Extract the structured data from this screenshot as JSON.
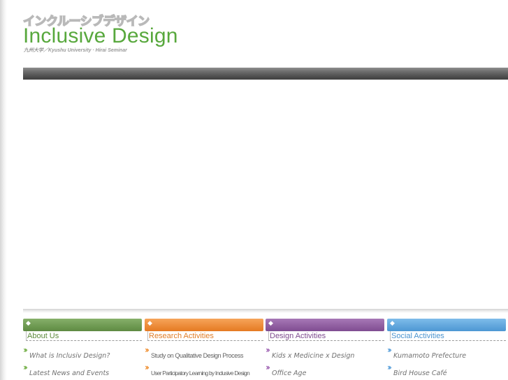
{
  "colors": {
    "green": "#6f9a52",
    "orange": "#ec8a32",
    "purple": "#8f5c9f",
    "blue": "#5aa3dd"
  },
  "header": {
    "logo_kana": "インクルーシブデザイン",
    "logo_title": "Inclusive Design",
    "logo_subtitle": "九州大学／Kyushu University · Hirai Seminar"
  },
  "footer": {
    "columns": [
      {
        "title": "About Us",
        "color": "#6f9a52",
        "title_color": "#5c8a3a",
        "items": [
          {
            "label": "What is Inclusiv Design?"
          },
          {
            "label": "Latest News and Events"
          }
        ]
      },
      {
        "title": "Research Activities",
        "color": "#ec8a32",
        "title_color": "#e07c26",
        "items": [
          {
            "label": "Study on Qualitative Design Process"
          },
          {
            "label": "User Participatory Learning by Inclusive Design"
          }
        ]
      },
      {
        "title": "Design Activities",
        "color": "#8f5c9f",
        "title_color": "#7d4a8e",
        "items": [
          {
            "label": "Kids x Medicine x Design"
          },
          {
            "label": "Office Age"
          }
        ]
      },
      {
        "title": "Social Activities",
        "color": "#5aa3dd",
        "title_color": "#4b94cf",
        "items": [
          {
            "label": "Kumamoto Prefecture"
          },
          {
            "label": "Bird House Café"
          }
        ]
      }
    ]
  }
}
